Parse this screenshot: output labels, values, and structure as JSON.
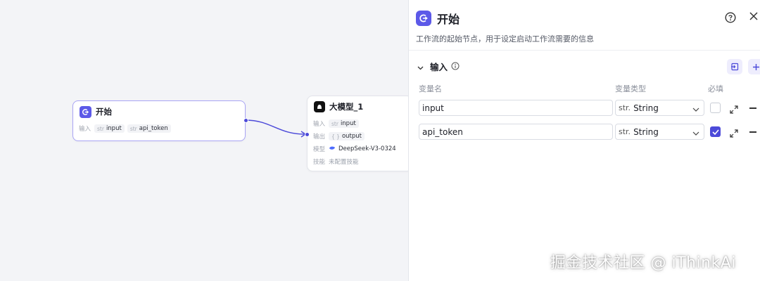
{
  "nodes": {
    "start": {
      "title": "开始",
      "input_label": "输入",
      "inputs": [
        {
          "type": "str",
          "name": "input"
        },
        {
          "type": "str",
          "name": "api_token"
        }
      ]
    },
    "llm": {
      "title": "大模型_1",
      "input_label": "输入",
      "input_chip": {
        "type": "str",
        "name": "input"
      },
      "output_label": "输出",
      "output_chip": {
        "type": "{ }",
        "name": "output"
      },
      "model_label": "模型",
      "model_value": "DeepSeek-V3-0324",
      "skill_label": "技能",
      "skill_value": "未配置技能"
    }
  },
  "panel": {
    "title": "开始",
    "description": "工作流的起始节点，用于设定启动工作流需要的信息",
    "section_title": "输入",
    "columns": {
      "name": "变量名",
      "type": "变量类型",
      "required": "必填"
    },
    "rows": [
      {
        "name": "input",
        "type_prefix": "str.",
        "type": "String",
        "required": false
      },
      {
        "name": "api_token",
        "type_prefix": "str.",
        "type": "String",
        "required": true
      }
    ]
  },
  "watermark": "掘金技术社区 @ iThinkAi",
  "colors": {
    "accent": "#5c59e8",
    "edge": "#4c4ad9",
    "canvas": "#f3f4f7"
  }
}
